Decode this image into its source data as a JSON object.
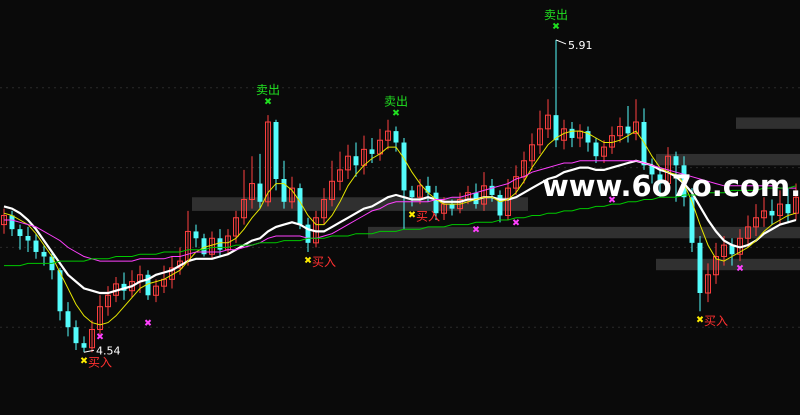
{
  "colors": {
    "background": "#0a0a0a",
    "up_candle": "#ff4040",
    "down_candle": "#54fcfc",
    "ma_white": "#ffffff",
    "ma_yellow": "#e6e600",
    "ma_magenta": "#ff40ff",
    "ma_green": "#00c800",
    "buy_label": "#ff3030",
    "sell_label": "#20e020",
    "band": "#3a3a3a",
    "grid": "#2a2a2a"
  },
  "watermark": "www.6o7o.com.",
  "chart_data": {
    "type": "candlestick",
    "title": "",
    "ylim": [
      4.3,
      6.05
    ],
    "grid": "horizontal dotted",
    "annotations": {
      "high": {
        "label": "5.91",
        "candle": 69
      },
      "low": {
        "label": "4.54",
        "candle": 10
      }
    },
    "signals": [
      {
        "type": "buy",
        "label": "买入",
        "candle": 10
      },
      {
        "type": "buy",
        "label": "买入",
        "candle": 38
      },
      {
        "type": "buy",
        "label": "买入",
        "candle": 51
      },
      {
        "type": "buy",
        "label": "买入",
        "candle": 87
      },
      {
        "type": "sell",
        "label": "卖出",
        "candle": 33
      },
      {
        "type": "sell",
        "label": "卖出",
        "candle": 49
      },
      {
        "type": "sell",
        "label": "卖出",
        "candle": 69
      }
    ],
    "extra_markers": [
      {
        "candle": 12,
        "value": 4.61
      },
      {
        "candle": 18,
        "value": 4.67
      },
      {
        "candle": 59,
        "value": 5.08
      },
      {
        "candle": 64,
        "value": 5.11
      },
      {
        "candle": 76,
        "value": 5.21
      },
      {
        "candle": 92,
        "value": 4.91
      }
    ],
    "band_zones": [
      {
        "from_candle": 24,
        "to_candle": 65,
        "low": 5.16,
        "high": 5.22
      },
      {
        "from_candle": 46,
        "to_candle": 99,
        "low": 5.04,
        "high": 5.09
      },
      {
        "from_candle": 82,
        "to_candle": 99,
        "low": 4.9,
        "high": 4.95
      },
      {
        "from_candle": 82,
        "to_candle": 99,
        "low": 5.36,
        "high": 5.41
      },
      {
        "from_candle": 92,
        "to_candle": 99,
        "low": 5.52,
        "high": 5.57
      }
    ],
    "candles": [
      [
        5.1,
        5.14,
        5.06,
        5.17
      ],
      [
        5.14,
        5.08,
        5.05,
        5.16
      ],
      [
        5.08,
        5.05,
        4.99,
        5.1
      ],
      [
        5.05,
        5.03,
        4.98,
        5.09
      ],
      [
        5.03,
        4.98,
        4.95,
        5.06
      ],
      [
        4.98,
        4.96,
        4.92,
        5.01
      ],
      [
        4.96,
        4.9,
        4.86,
        4.98
      ],
      [
        4.9,
        4.72,
        4.68,
        4.91
      ],
      [
        4.72,
        4.65,
        4.61,
        4.76
      ],
      [
        4.65,
        4.58,
        4.55,
        4.68
      ],
      [
        4.58,
        4.56,
        4.54,
        4.61
      ],
      [
        4.56,
        4.64,
        4.54,
        4.68
      ],
      [
        4.64,
        4.74,
        4.62,
        4.79
      ],
      [
        4.74,
        4.79,
        4.7,
        4.83
      ],
      [
        4.79,
        4.84,
        4.76,
        4.87
      ],
      [
        4.84,
        4.81,
        4.77,
        4.89
      ],
      [
        4.81,
        4.85,
        4.78,
        4.9
      ],
      [
        4.85,
        4.88,
        4.8,
        4.92
      ],
      [
        4.88,
        4.79,
        4.77,
        4.9
      ],
      [
        4.79,
        4.83,
        4.76,
        4.86
      ],
      [
        4.83,
        4.86,
        4.8,
        4.92
      ],
      [
        4.86,
        4.91,
        4.82,
        4.96
      ],
      [
        4.91,
        4.94,
        4.88,
        5.0
      ],
      [
        4.94,
        5.07,
        4.92,
        5.16
      ],
      [
        5.07,
        5.04,
        5.0,
        5.1
      ],
      [
        5.04,
        4.97,
        4.96,
        5.06
      ],
      [
        4.97,
        5.04,
        4.95,
        5.07
      ],
      [
        5.04,
        4.99,
        4.96,
        5.08
      ],
      [
        4.99,
        5.05,
        4.97,
        5.08
      ],
      [
        5.05,
        5.13,
        5.02,
        5.16
      ],
      [
        5.13,
        5.21,
        5.1,
        5.34
      ],
      [
        5.21,
        5.28,
        5.17,
        5.4
      ],
      [
        5.28,
        5.2,
        5.17,
        5.41
      ],
      [
        5.2,
        5.55,
        5.18,
        5.58
      ],
      [
        5.55,
        5.3,
        5.25,
        5.56
      ],
      [
        5.3,
        5.2,
        5.17,
        5.38
      ],
      [
        5.2,
        5.26,
        5.17,
        5.31
      ],
      [
        5.26,
        5.1,
        5.08,
        5.28
      ],
      [
        5.1,
        5.02,
        4.98,
        5.13
      ],
      [
        5.02,
        5.13,
        5.0,
        5.16
      ],
      [
        5.13,
        5.21,
        5.1,
        5.26
      ],
      [
        5.21,
        5.29,
        5.18,
        5.38
      ],
      [
        5.29,
        5.34,
        5.25,
        5.42
      ],
      [
        5.34,
        5.4,
        5.3,
        5.45
      ],
      [
        5.4,
        5.36,
        5.31,
        5.46
      ],
      [
        5.36,
        5.43,
        5.32,
        5.49
      ],
      [
        5.43,
        5.41,
        5.37,
        5.48
      ],
      [
        5.41,
        5.47,
        5.38,
        5.52
      ],
      [
        5.47,
        5.51,
        5.43,
        5.56
      ],
      [
        5.51,
        5.46,
        5.42,
        5.53
      ],
      [
        5.46,
        5.25,
        5.08,
        5.48
      ],
      [
        5.25,
        5.22,
        5.18,
        5.27
      ],
      [
        5.22,
        5.27,
        5.19,
        5.3
      ],
      [
        5.27,
        5.24,
        5.2,
        5.31
      ],
      [
        5.24,
        5.15,
        5.12,
        5.27
      ],
      [
        5.15,
        5.19,
        5.12,
        5.22
      ],
      [
        5.19,
        5.17,
        5.14,
        5.21
      ],
      [
        5.17,
        5.21,
        5.15,
        5.24
      ],
      [
        5.21,
        5.24,
        5.19,
        5.27
      ],
      [
        5.24,
        5.19,
        5.17,
        5.28
      ],
      [
        5.19,
        5.27,
        5.16,
        5.33
      ],
      [
        5.27,
        5.23,
        5.2,
        5.3
      ],
      [
        5.23,
        5.14,
        5.11,
        5.25
      ],
      [
        5.14,
        5.26,
        5.12,
        5.3
      ],
      [
        5.26,
        5.31,
        5.23,
        5.36
      ],
      [
        5.31,
        5.38,
        5.28,
        5.42
      ],
      [
        5.38,
        5.45,
        5.34,
        5.5
      ],
      [
        5.45,
        5.52,
        5.41,
        5.6
      ],
      [
        5.52,
        5.58,
        5.48,
        5.65
      ],
      [
        5.58,
        5.47,
        5.44,
        5.91
      ],
      [
        5.47,
        5.52,
        5.43,
        5.56
      ],
      [
        5.52,
        5.48,
        5.44,
        5.55
      ],
      [
        5.48,
        5.51,
        5.44,
        5.54
      ],
      [
        5.51,
        5.46,
        5.42,
        5.53
      ],
      [
        5.46,
        5.4,
        5.37,
        5.48
      ],
      [
        5.4,
        5.44,
        5.37,
        5.47
      ],
      [
        5.44,
        5.49,
        5.41,
        5.53
      ],
      [
        5.49,
        5.53,
        5.46,
        5.57
      ],
      [
        5.53,
        5.5,
        5.46,
        5.62
      ],
      [
        5.5,
        5.55,
        5.47,
        5.65
      ],
      [
        5.55,
        5.36,
        5.34,
        5.61
      ],
      [
        5.36,
        5.32,
        5.28,
        5.39
      ],
      [
        5.32,
        5.28,
        5.22,
        5.35
      ],
      [
        5.28,
        5.4,
        5.26,
        5.44
      ],
      [
        5.4,
        5.36,
        5.2,
        5.42
      ],
      [
        5.36,
        5.22,
        5.18,
        5.4
      ],
      [
        5.22,
        5.02,
        4.98,
        5.26
      ],
      [
        5.02,
        4.8,
        4.72,
        5.05
      ],
      [
        4.8,
        4.88,
        4.76,
        4.93
      ],
      [
        4.88,
        4.96,
        4.84,
        5.02
      ],
      [
        4.96,
        5.01,
        4.92,
        5.05
      ],
      [
        5.01,
        4.97,
        4.92,
        5.04
      ],
      [
        4.97,
        5.04,
        4.94,
        5.08
      ],
      [
        5.04,
        5.09,
        5.0,
        5.14
      ],
      [
        5.09,
        5.13,
        5.05,
        5.19
      ],
      [
        5.13,
        5.16,
        5.09,
        5.22
      ],
      [
        5.16,
        5.14,
        5.1,
        5.21
      ],
      [
        5.14,
        5.19,
        5.1,
        5.25
      ],
      [
        5.19,
        5.15,
        5.11,
        5.26
      ],
      [
        5.15,
        5.22,
        5.12,
        5.28
      ]
    ],
    "series": [
      {
        "name": "",
        "color": "#ffffff",
        "width": 2.2,
        "values": [
          5.18,
          5.17,
          5.15,
          5.12,
          5.08,
          5.03,
          4.98,
          4.93,
          4.88,
          4.85,
          4.82,
          4.81,
          4.8,
          4.8,
          4.81,
          4.82,
          4.83,
          4.85,
          4.86,
          4.88,
          4.89,
          4.9,
          4.92,
          4.94,
          4.95,
          4.95,
          4.95,
          4.96,
          4.97,
          4.99,
          5.01,
          5.03,
          5.04,
          5.07,
          5.09,
          5.1,
          5.11,
          5.1,
          5.08,
          5.07,
          5.07,
          5.09,
          5.11,
          5.13,
          5.15,
          5.17,
          5.18,
          5.2,
          5.22,
          5.23,
          5.22,
          5.21,
          5.21,
          5.22,
          5.21,
          5.2,
          5.2,
          5.2,
          5.21,
          5.21,
          5.22,
          5.22,
          5.21,
          5.21,
          5.22,
          5.24,
          5.26,
          5.28,
          5.3,
          5.31,
          5.33,
          5.34,
          5.35,
          5.35,
          5.34,
          5.34,
          5.35,
          5.36,
          5.37,
          5.38,
          5.37,
          5.36,
          5.34,
          5.33,
          5.31,
          5.28,
          5.24,
          5.18,
          5.12,
          5.07,
          5.03,
          5.01,
          5.0,
          5.01,
          5.03,
          5.06,
          5.08,
          5.1,
          5.11,
          5.12
        ]
      },
      {
        "name": "",
        "color": "#e6e600",
        "width": 1,
        "values": [
          5.15,
          5.14,
          5.12,
          5.1,
          5.06,
          5.01,
          4.96,
          4.89,
          4.82,
          4.75,
          4.7,
          4.67,
          4.66,
          4.67,
          4.7,
          4.74,
          4.78,
          4.82,
          4.84,
          4.85,
          4.86,
          4.88,
          4.9,
          4.94,
          4.98,
          5.0,
          5.01,
          5.02,
          5.02,
          5.04,
          5.08,
          5.13,
          5.17,
          5.24,
          5.28,
          5.28,
          5.25,
          5.2,
          5.14,
          5.1,
          5.1,
          5.14,
          5.2,
          5.27,
          5.32,
          5.36,
          5.39,
          5.41,
          5.44,
          5.44,
          5.39,
          5.33,
          5.28,
          5.24,
          5.21,
          5.19,
          5.19,
          5.19,
          5.2,
          5.21,
          5.22,
          5.22,
          5.2,
          5.21,
          5.24,
          5.29,
          5.35,
          5.4,
          5.45,
          5.48,
          5.5,
          5.51,
          5.51,
          5.5,
          5.48,
          5.46,
          5.46,
          5.47,
          5.49,
          5.51,
          5.46,
          5.4,
          5.35,
          5.33,
          5.32,
          5.28,
          5.2,
          5.1,
          5.01,
          4.95,
          4.94,
          4.96,
          4.98,
          5.0,
          5.03,
          5.07,
          5.1,
          5.12,
          5.14,
          5.15
        ]
      },
      {
        "name": "",
        "color": "#ff40ff",
        "width": 1,
        "values": [
          5.12,
          5.12,
          5.11,
          5.1,
          5.09,
          5.07,
          5.05,
          5.03,
          5.0,
          4.98,
          4.96,
          4.95,
          4.94,
          4.94,
          4.94,
          4.94,
          4.94,
          4.95,
          4.95,
          4.95,
          4.95,
          4.96,
          4.96,
          4.97,
          4.98,
          4.98,
          4.98,
          4.98,
          4.99,
          4.99,
          5.0,
          5.01,
          5.02,
          5.04,
          5.05,
          5.05,
          5.05,
          5.05,
          5.04,
          5.04,
          5.05,
          5.06,
          5.08,
          5.1,
          5.12,
          5.14,
          5.16,
          5.17,
          5.19,
          5.2,
          5.2,
          5.2,
          5.2,
          5.2,
          5.21,
          5.21,
          5.22,
          5.22,
          5.23,
          5.24,
          5.25,
          5.26,
          5.27,
          5.28,
          5.3,
          5.31,
          5.33,
          5.34,
          5.35,
          5.36,
          5.37,
          5.37,
          5.38,
          5.38,
          5.38,
          5.38,
          5.38,
          5.38,
          5.38,
          5.38,
          5.37,
          5.36,
          5.35,
          5.34,
          5.33,
          5.32,
          5.31,
          5.3,
          5.29,
          5.28,
          5.27,
          5.27,
          5.27,
          5.27,
          5.27,
          5.27,
          5.27,
          5.26,
          5.26,
          5.26
        ]
      },
      {
        "name": "",
        "color": "#00c800",
        "width": 1,
        "values": [
          4.92,
          4.92,
          4.92,
          4.93,
          4.93,
          4.93,
          4.93,
          4.94,
          4.94,
          4.94,
          4.94,
          4.95,
          4.95,
          4.95,
          4.96,
          4.96,
          4.96,
          4.97,
          4.97,
          4.97,
          4.98,
          4.98,
          4.98,
          4.99,
          4.99,
          4.99,
          5.0,
          5.0,
          5.0,
          5.01,
          5.01,
          5.01,
          5.02,
          5.02,
          5.02,
          5.03,
          5.03,
          5.03,
          5.04,
          5.04,
          5.04,
          5.05,
          5.05,
          5.05,
          5.06,
          5.06,
          5.06,
          5.07,
          5.07,
          5.07,
          5.08,
          5.08,
          5.08,
          5.09,
          5.09,
          5.09,
          5.1,
          5.1,
          5.1,
          5.11,
          5.11,
          5.11,
          5.12,
          5.12,
          5.13,
          5.13,
          5.14,
          5.14,
          5.15,
          5.15,
          5.16,
          5.16,
          5.17,
          5.17,
          5.18,
          5.18,
          5.19,
          5.19,
          5.2,
          5.2,
          5.21,
          5.21,
          5.22,
          5.22,
          5.22,
          5.23,
          5.23,
          5.23,
          5.24,
          5.24,
          5.24,
          5.25,
          5.25,
          5.25,
          5.25,
          5.26,
          5.26,
          5.26,
          5.26,
          5.27
        ]
      }
    ]
  }
}
